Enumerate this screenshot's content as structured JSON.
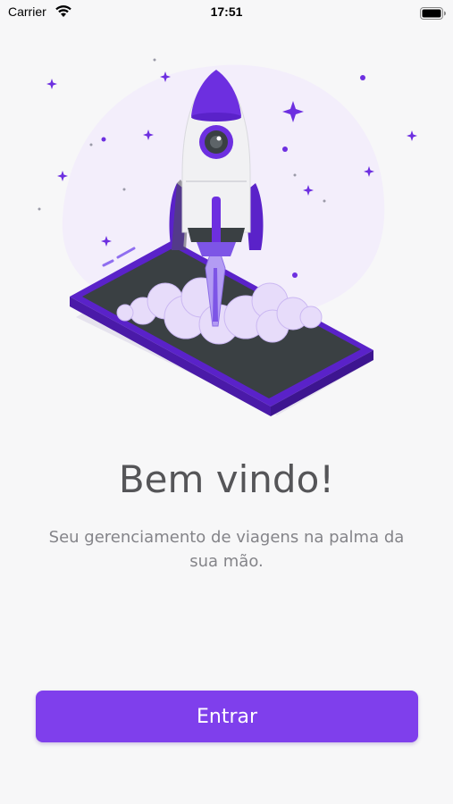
{
  "status_bar": {
    "carrier": "Carrier",
    "time": "17:51",
    "wifi_icon": "wifi-icon",
    "battery_icon": "battery-icon"
  },
  "illustration": {
    "subject": "rocket-launching-from-phone-illustration"
  },
  "welcome": {
    "title": "Bem vindo!",
    "subtitle": "Seu gerenciamento de viagens na palma da sua mão."
  },
  "actions": {
    "enter_label": "Entrar"
  },
  "colors": {
    "accent": "#7f3fec",
    "title": "#555558",
    "subtitle": "#848489",
    "background": "#f7f7f8"
  }
}
